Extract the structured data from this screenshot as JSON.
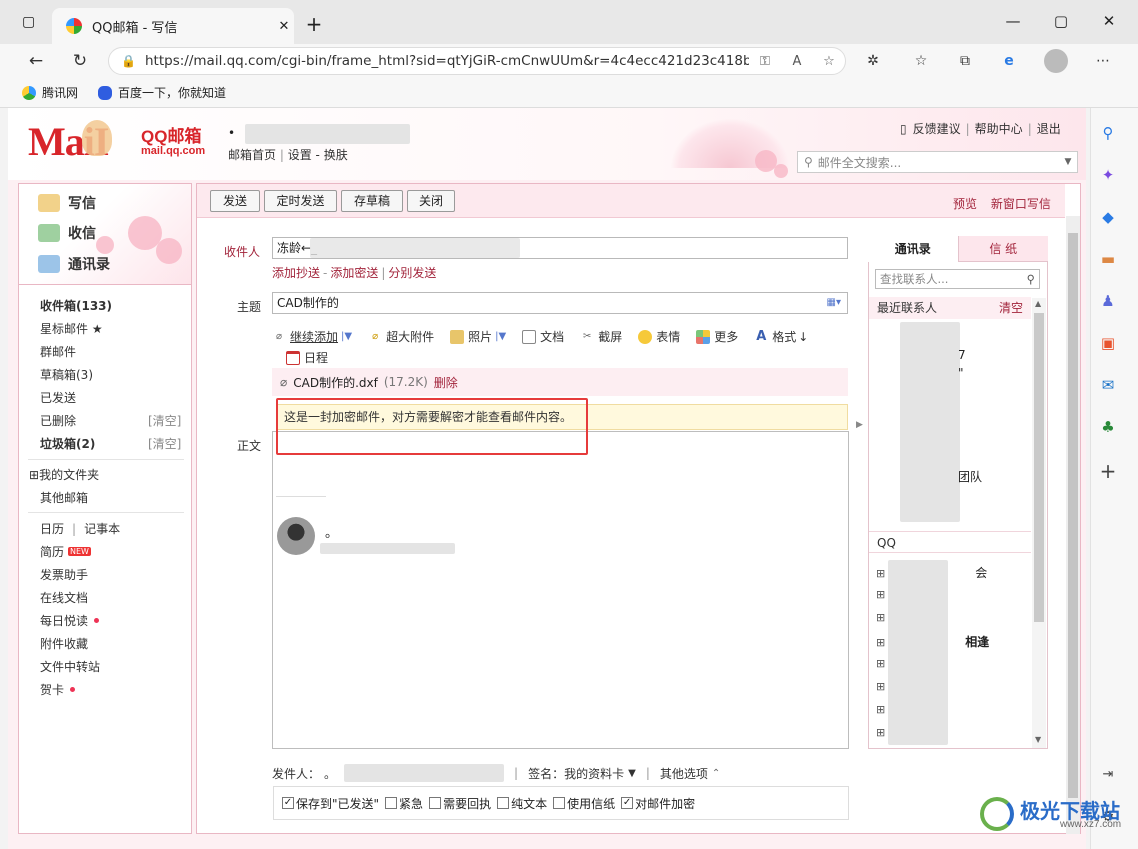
{
  "browser": {
    "tab_title": "QQ邮箱 - 写信",
    "url": "https://mail.qq.com/cgi-bin/frame_html?sid=qtYjGiR-cmCnwUUm&r=4c4ecc421d23c418b5...",
    "favorites": [
      {
        "label": "腾讯网"
      },
      {
        "label": "百度一下，你就知道"
      }
    ]
  },
  "header": {
    "logo_main": "MaiI",
    "logo_qq": "QQ邮箱",
    "logo_domain": "mail.qq.com",
    "user_dot": "•",
    "user_links": [
      "邮箱首页",
      "设置",
      "换肤"
    ],
    "top_links": [
      "反馈建议",
      "帮助中心",
      "退出"
    ],
    "search_placeholder": "邮件全文搜索..."
  },
  "leftnav": {
    "primary": [
      "写信",
      "收信",
      "通讯录"
    ],
    "folders": [
      {
        "label": "收件箱(133)",
        "bold": true
      },
      {
        "label": "星标邮件 ★"
      },
      {
        "label": "群邮件"
      },
      {
        "label": "草稿箱(3)"
      },
      {
        "label": "已发送"
      },
      {
        "label": "已删除",
        "clear": "[清空]"
      },
      {
        "label": "垃圾箱(2)",
        "bold": true,
        "clear": "[清空]"
      }
    ],
    "my_folders": "我的文件夹",
    "other_mailbox": "其他邮箱",
    "calendar": "日历",
    "notebook": "记事本",
    "resume": "简历",
    "new_badge": "NEW",
    "tools": [
      "发票助手",
      "在线文档",
      "每日悦读",
      "附件收藏",
      "文件中转站",
      "贺卡"
    ]
  },
  "toolbar": {
    "send": "发送",
    "timed_send": "定时发送",
    "save_draft": "存草稿",
    "close": "关闭",
    "preview": "预览",
    "new_window": "新窗口写信"
  },
  "form": {
    "to_label": "收件人",
    "to_value": "冻龄←_",
    "cc_links": [
      "添加抄送",
      "添加密送",
      "分别发送"
    ],
    "subject_label": "主题",
    "subject_value": "CAD制作的",
    "attach_tools": [
      "继续添加",
      "超大附件",
      "照片",
      "文档",
      "截屏",
      "表情",
      "更多",
      "格式",
      "日程"
    ],
    "attachment_name": "CAD制作的.dxf",
    "attachment_size": "(17.2K)",
    "attachment_delete": "删除",
    "body_label": "正文",
    "encrypted_notice": "这是一封加密邮件，对方需要解密才能查看邮件内容。",
    "signature_dot": "。"
  },
  "contacts": {
    "tab_contacts": "通讯录",
    "tab_paper": "信  纸",
    "search_placeholder": "查找联系人...",
    "recent_header": "最近联系人",
    "recent_clear": "清空",
    "recent_snippets": [
      "7",
      "\"",
      "团队"
    ],
    "qq_header": "QQ",
    "group_snippets": [
      "会",
      "",
      "",
      "相逢",
      "",
      "",
      "",
      ""
    ]
  },
  "bottom": {
    "sender_label": "发件人：",
    "sender_dot": "。",
    "signature_label": "签名：",
    "signature_value": "我的资料卡",
    "other_options": "其他选项",
    "options": [
      {
        "label": "保存到\"已发送\"",
        "checked": true
      },
      {
        "label": "紧急",
        "checked": false
      },
      {
        "label": "需要回执",
        "checked": false
      },
      {
        "label": "纯文本",
        "checked": false
      },
      {
        "label": "使用信纸",
        "checked": false
      },
      {
        "label": "对邮件加密",
        "checked": true
      }
    ]
  },
  "watermark": {
    "title": "极光下载站",
    "sub": "www.xz7.com"
  },
  "colors": {
    "accent_red": "#a2243b",
    "logo_red": "#d8252a",
    "highlight_box": "#e63b3b",
    "notice_bg": "#fff9dd"
  }
}
